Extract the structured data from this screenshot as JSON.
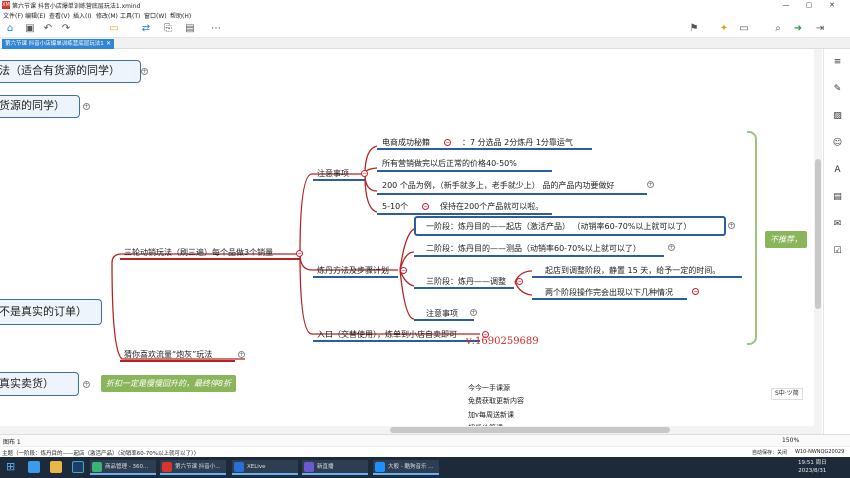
{
  "window": {
    "title": "第六节课 抖音小店爆单训练营底层玩法1.xmind",
    "logo": "XM",
    "controls": {
      "minimize": "—",
      "maximize": "▢",
      "close": "✕"
    }
  },
  "menu": [
    "文件(F)",
    "编辑(E)",
    "查看(V)",
    "插入(I)",
    "修改(M)",
    "工具(T)",
    "窗口(W)",
    "帮助(H)"
  ],
  "toolbar": {
    "icons": [
      "home-icon",
      "save-icon",
      "undo-icon",
      "redo-icon",
      "topic-icon",
      "subtopic-icon",
      "relationship-icon",
      "summary-icon",
      "more-icon",
      "marker-icon",
      "idea-icon",
      "present-icon",
      "search-icon",
      "share-icon",
      "export-icon"
    ]
  },
  "tab": {
    "label": "第六节课 抖音小店爆单训练营底层玩法1",
    "close": "✕"
  },
  "mindmap": {
    "left_nodes": {
      "n1": "法（适合有货源的同学）",
      "n2": "货源的同学）",
      "n3": "不是真实的订单）",
      "n4": "真实卖货）"
    },
    "green_tag_left": "折扣一定是慢慢回升的，最终停8折",
    "green_tag_right": "不推荐，",
    "branch_main": "三轮动销玩法（刷三遍）每个品做3个销量",
    "branch_guess": "猜你喜欢流量“炮灰”玩法",
    "notes": "注意事项",
    "notes_items": {
      "a": "电商成功秘籍",
      "a_suffix": "：7 分选品 2分炼丹 1分靠运气",
      "b": "所有营销做完以后正常的价格40-50%",
      "c": "200 个品为例，（新手就多上，老手就少上） 品的产品内功要做好",
      "d": "5-10个",
      "d_suffix": "保持在200个产品就可以啦。"
    },
    "method": "炼丹方法及步骤计划",
    "stages": {
      "s1": "一阶段：炼丹目的——起店（激活产品）  （动销率60-70%以上就可以了）",
      "s2": "二阶段：炼丹目的——测品（动销率60-70%以上就可以了）",
      "s3": "三阶段：炼丹——调整",
      "s3a": "起店到调整阶段，静置 15 天，给予一定的时间。",
      "s3b": "两个阶段操作完会出现以下几种情况",
      "s4": "注意事项"
    },
    "entry": "入口（交替使用），炼单到小店自卖即可"
  },
  "watermark": {
    "phone": "v:1690259689",
    "lines": [
      "今今一手课源",
      "免费获取更新内容",
      "加v每周送新课",
      "超低价筹课"
    ]
  },
  "sheet": {
    "tab": "图布 1",
    "zoom": "150%"
  },
  "status": {
    "left": "主题（一阶段：炼丹目的——起店（激活产品）（动销率60-70%以上就可以了））",
    "autosave": "自动保存：关闭",
    "machine": "W10-NWNQG20029"
  },
  "taskbar": {
    "apps": [
      "商品管理 - 360...",
      "第六节课 抖音小...",
      "XELive",
      "新直播",
      "大般 - 酷狗音乐 ..."
    ],
    "time": "19:51 周日",
    "date": "2023/8/31"
  },
  "ime": "S中·ツ简"
}
